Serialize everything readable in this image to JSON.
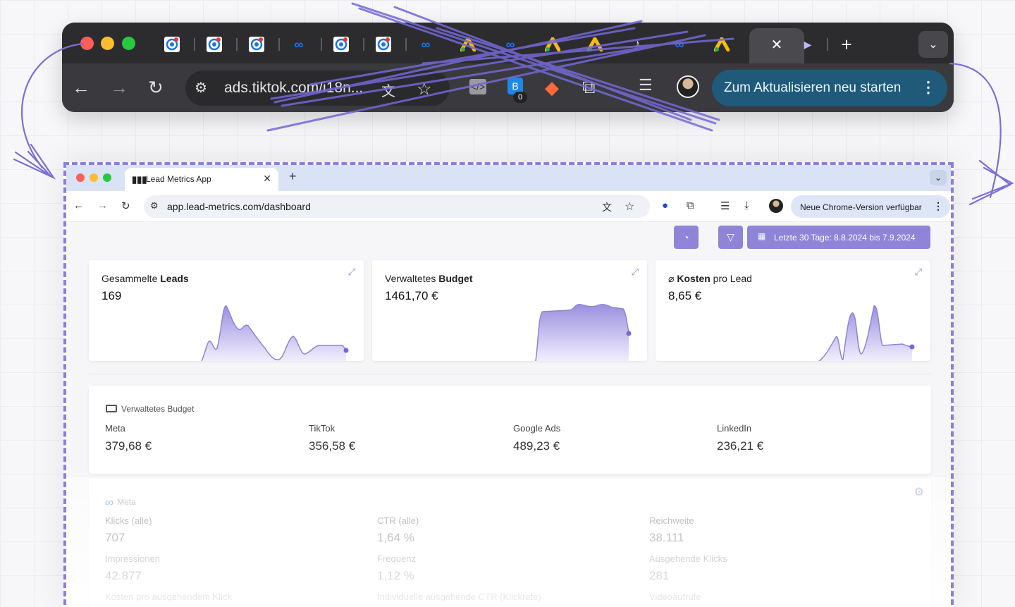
{
  "old_browser": {
    "url": "ads.tiktok.com/i18n...",
    "update_label": "Zum Aktualisieren neu starten",
    "badge_count": "0",
    "tabs": [
      "target-icon",
      "target-icon",
      "target-icon",
      "meta-icon",
      "target-icon",
      "target-icon",
      "meta-icon",
      "google-ads-icon",
      "meta-icon",
      "google-ads-icon",
      "google-ads-icon",
      "tiktok-icon",
      "meta-icon",
      "google-ads-icon"
    ]
  },
  "new_browser": {
    "tab_title": "Lead Metrics App",
    "url": "app.lead-metrics.com/dashboard",
    "update_label": "Neue Chrome-Version verfügbar"
  },
  "toolbar": {
    "date_range": "Letzte 30 Tage: 8.8.2024 bis 7.9.2024"
  },
  "kpis": [
    {
      "title_pre": "Gesammelte ",
      "title_bold": "Leads",
      "title_post": "",
      "value": "169"
    },
    {
      "title_pre": "Verwaltetes ",
      "title_bold": "Budget",
      "title_post": "",
      "value": "1461,70 €"
    },
    {
      "title_pre": "⌀ ",
      "title_bold": "Kosten",
      "title_post": " pro Lead",
      "value": "8,65 €"
    }
  ],
  "budget": {
    "heading": "Verwaltetes Budget",
    "items": [
      {
        "label": "Meta",
        "value": "379,68 €"
      },
      {
        "label": "TikTok",
        "value": "356,58 €"
      },
      {
        "label": "Google Ads",
        "value": "489,23 €"
      },
      {
        "label": "LinkedIn",
        "value": "236,21 €"
      }
    ]
  },
  "meta": {
    "heading": "Meta",
    "items": [
      {
        "label": "Klicks (alle)",
        "value": "707"
      },
      {
        "label": "CTR (alle)",
        "value": "1,64 %"
      },
      {
        "label": "Reichweite",
        "value": "38.111"
      },
      {
        "label": "Impressionen",
        "value": "42.877"
      },
      {
        "label": "Frequenz",
        "value": "1,12 %"
      },
      {
        "label": "Ausgehende Klicks",
        "value": "281"
      },
      {
        "label": "Kosten pro ausgehendem Klick",
        "value": ""
      },
      {
        "label": "Individuelle ausgehende CTR (Klickrate)",
        "value": ""
      },
      {
        "label": "Videoaufrufe",
        "value": ""
      }
    ]
  },
  "colors": {
    "accent": "#8e84d8",
    "scribble": "#7b6fd6",
    "old_update_bg": "#1f5a7a"
  }
}
